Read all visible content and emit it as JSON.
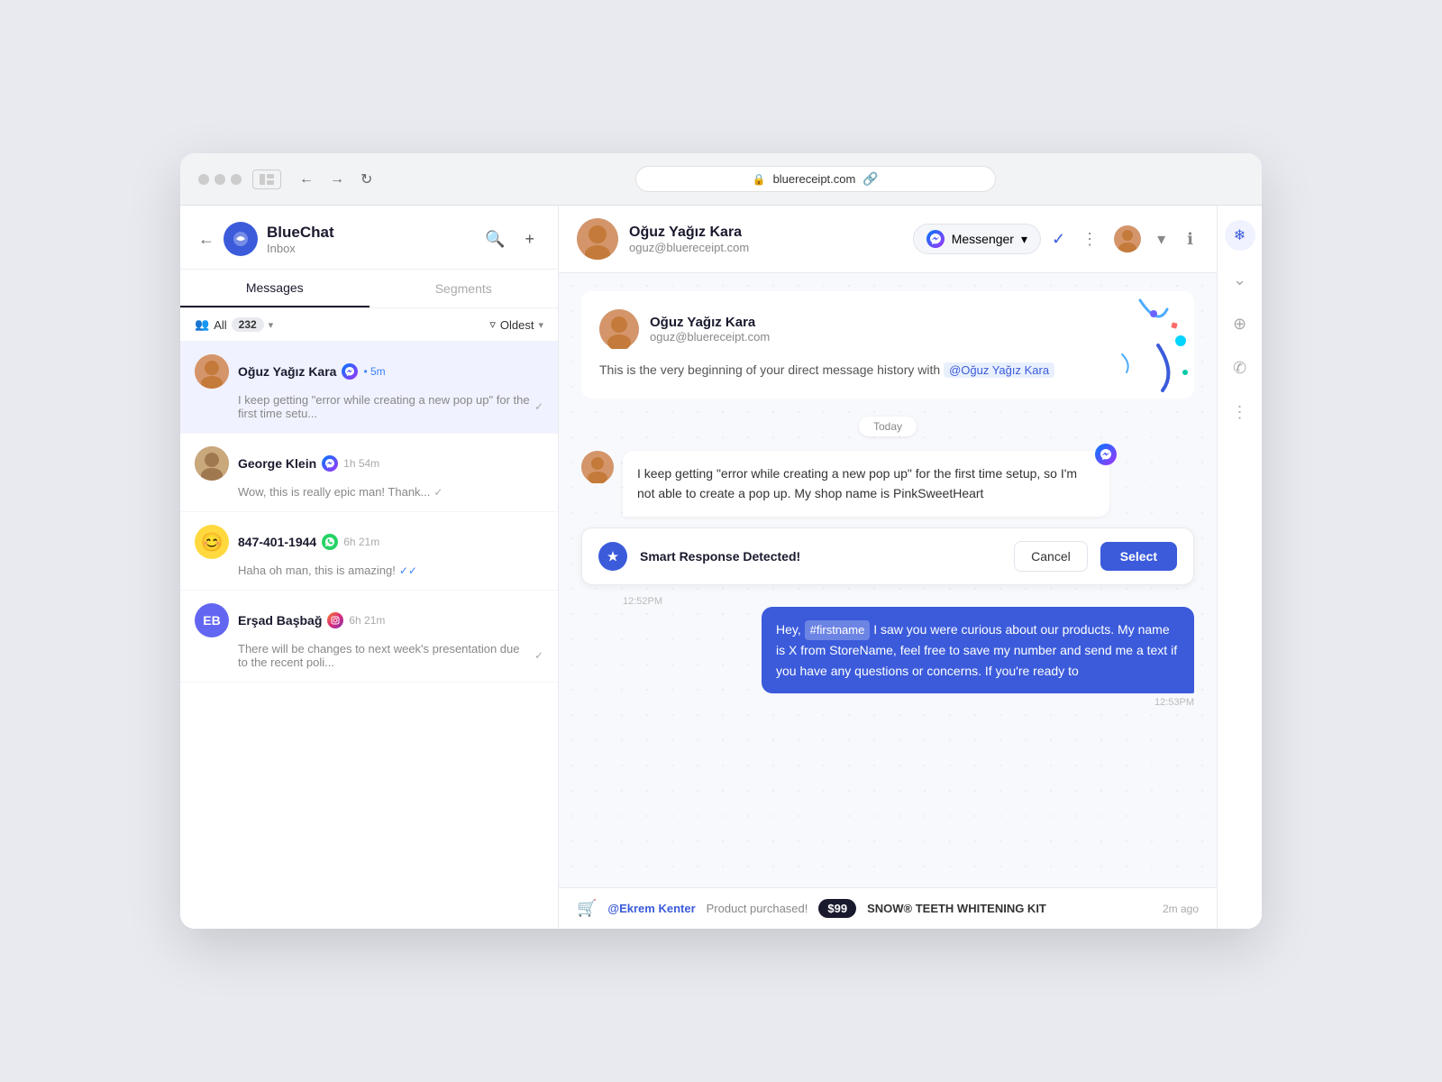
{
  "browser": {
    "url": "bluereceipt.com",
    "dots": [
      "gray",
      "gray",
      "gray"
    ]
  },
  "app": {
    "name": "BlueChat",
    "inbox": "Inbox"
  },
  "tabs": {
    "messages": "Messages",
    "segments": "Segments"
  },
  "filter": {
    "all_label": "All",
    "count": "232",
    "sort": "Oldest"
  },
  "conversations": [
    {
      "id": "ouz",
      "name": "Oğuz Yağız Kara",
      "platform": "messenger",
      "time": "5m",
      "dot": "• 5m",
      "preview": "I keep getting \"error while creating a new pop up\" for the first time setu...",
      "read": false,
      "active": true
    },
    {
      "id": "george",
      "name": "George Klein",
      "platform": "messenger",
      "time": "1h 54m",
      "dot": "1h 54m",
      "preview": "Wow, this is really epic man! Thank...",
      "read": false,
      "active": false
    },
    {
      "id": "phone",
      "name": "847-401-1944",
      "platform": "whatsapp",
      "time": "6h 21m",
      "dot": "6h 21m",
      "preview": "Haha oh man, this is amazing!",
      "read": true,
      "active": false
    },
    {
      "id": "ersad",
      "name": "Erşad Başbağ",
      "platform": "instagram",
      "time": "6h 21m",
      "dot": "6h 21m",
      "preview": "There will be changes to next week's presentation due to the recent poli...",
      "read": false,
      "active": false
    }
  ],
  "chat": {
    "contact_name": "Oğuz Yağız Kara",
    "contact_email": "oguz@bluereceipt.com",
    "channel": "Messenger",
    "history_title": "Oğuz Yağız Kara",
    "history_email": "oguz@bluereceipt.com",
    "history_text": "This is the very beginning of your direct message history with",
    "mention": "@Oğuz Yağız Kara",
    "day_divider": "Today",
    "incoming_message": "I keep getting \"error while creating a new pop up\" for the first time setup, so I'm not able to create a pop up. My shop name is PinkSweetHeart",
    "incoming_time": "12:52PM",
    "smart_response_label": "Smart Response Detected!",
    "cancel_label": "Cancel",
    "select_label": "Select",
    "outgoing_prefix": "Hey,",
    "firstname_tag": "#firstname",
    "outgoing_message": " I saw you were curious about our products. My name is X from StoreName, feel free to save my number and send me a text if you have any questions or concerns. If you're ready to",
    "outgoing_time": "12:53PM",
    "notify_user": "@Ekrem Kenter",
    "notify_action": "Product purchased!",
    "notify_price": "$99",
    "notify_product": "SNOW® TEETH WHITENING KIT",
    "notify_time": "2m ago"
  }
}
